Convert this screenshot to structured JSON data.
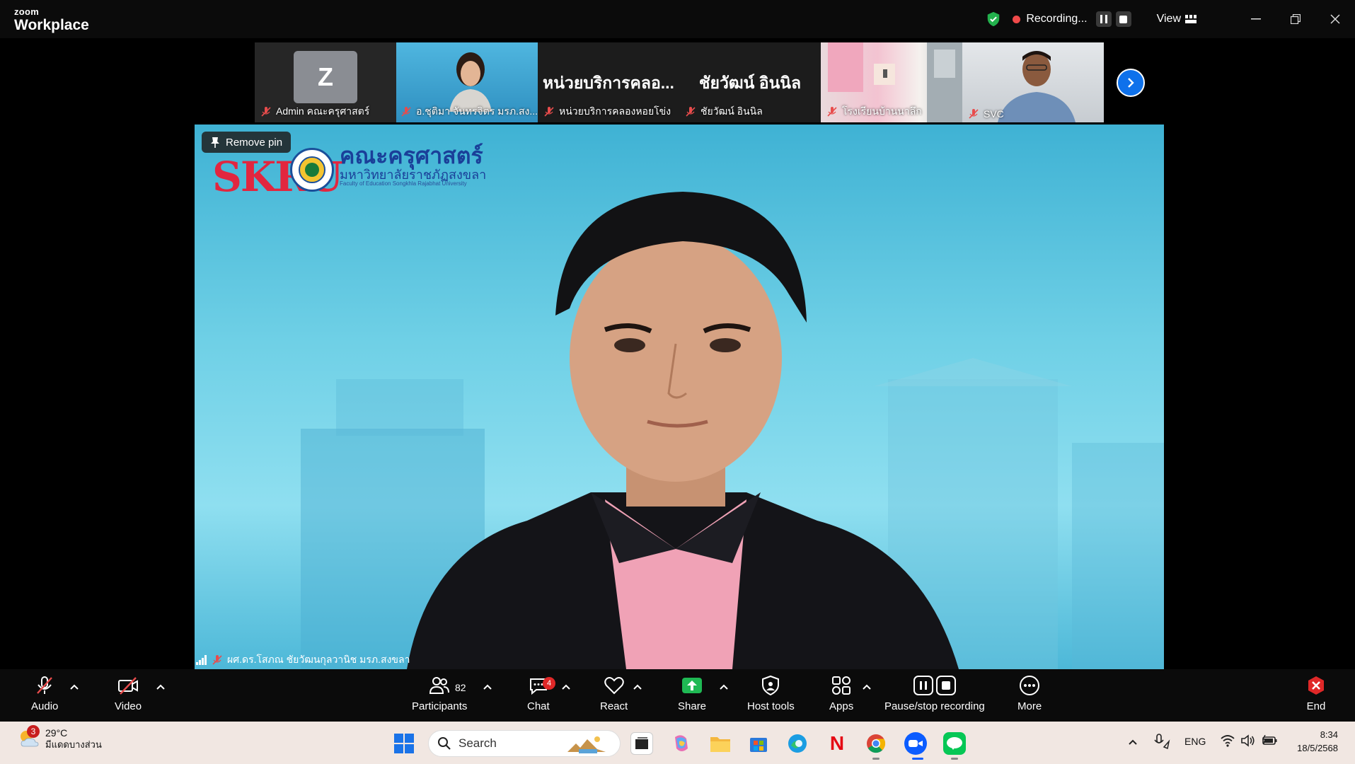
{
  "app": {
    "brand_small": "zoom",
    "brand_big": "Workplace"
  },
  "titlebar": {
    "recording_label": "Recording...",
    "view_label": "View"
  },
  "thumbnails": [
    {
      "name": "Admin คณะครุศาสตร์",
      "avatar_letter": "Z"
    },
    {
      "name": "อ.ชุติมา จันทรจิตร มรภ.สง..."
    },
    {
      "name": "หน่วยบริการคลองหอยโข่ง",
      "display_name": "หน่วยบริการคลอ..."
    },
    {
      "name": "ชัยวัฒน์ อินนิล",
      "display_name": "ชัยวัฒน์ อินนิล"
    },
    {
      "name": "โรงเรียนบ้านนาลึก"
    },
    {
      "name": "SVC"
    }
  ],
  "main_video": {
    "remove_pin_label": "Remove pin",
    "logo_text": "SKRU",
    "faculty_name": "คณะครุศาสตร์",
    "university_name": "มหาวิทยาลัยราชภัฏสงขลา",
    "faculty_english": "Faculty of Education Songkhla Rajabhat University",
    "speaker_name": "ผศ.ดร.โสภณ ชัยวัฒนกุลวานิช มรภ.สงขลา"
  },
  "toolbar": {
    "audio": "Audio",
    "video": "Video",
    "participants": "Participants",
    "participants_count": "82",
    "chat": "Chat",
    "chat_badge": "4",
    "react": "React",
    "share": "Share",
    "host_tools": "Host tools",
    "apps": "Apps",
    "pause_stop": "Pause/stop recording",
    "more": "More",
    "end": "End"
  },
  "taskbar": {
    "weather_badge": "3",
    "weather_temp": "29°C",
    "weather_desc": "มีแดดบางส่วน",
    "search_label": "Search",
    "language": "ENG",
    "time": "8:34",
    "date": "18/5/2568"
  },
  "colors": {
    "accent": "#0e71eb",
    "share_green": "#1fb954",
    "end_red": "#e02828",
    "recording_red": "#f04a4a"
  }
}
